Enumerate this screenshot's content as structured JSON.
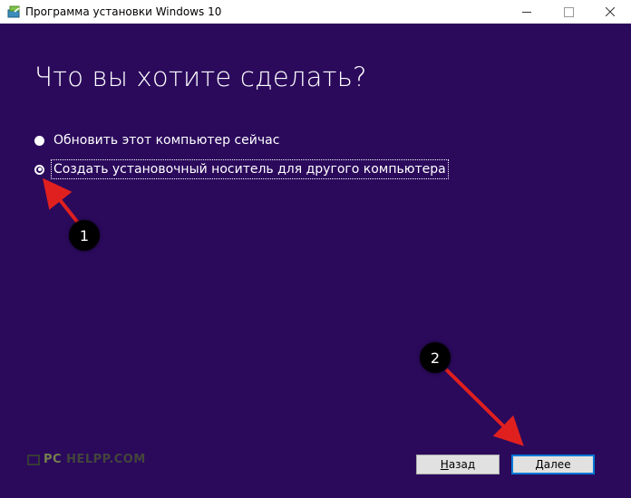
{
  "window": {
    "title": "Программа установки Windows 10",
    "background": "#2b0a5c"
  },
  "main": {
    "heading": "Что вы хотите сделать?",
    "options": [
      {
        "label": "Обновить этот компьютер сейчас",
        "selected": false
      },
      {
        "label": "Создать установочный носитель для другого компьютера",
        "selected": true
      }
    ]
  },
  "annotations": {
    "badge_1": "1",
    "badge_2": "2",
    "arrow_color": "#e0201f"
  },
  "watermark": {
    "text_pc": "PC",
    "text_rest": "HELPP.COM"
  },
  "footer": {
    "back_label_accel": "Н",
    "back_label_rest": "азад",
    "next_label_accel": "Д",
    "next_label_rest": "алее"
  }
}
